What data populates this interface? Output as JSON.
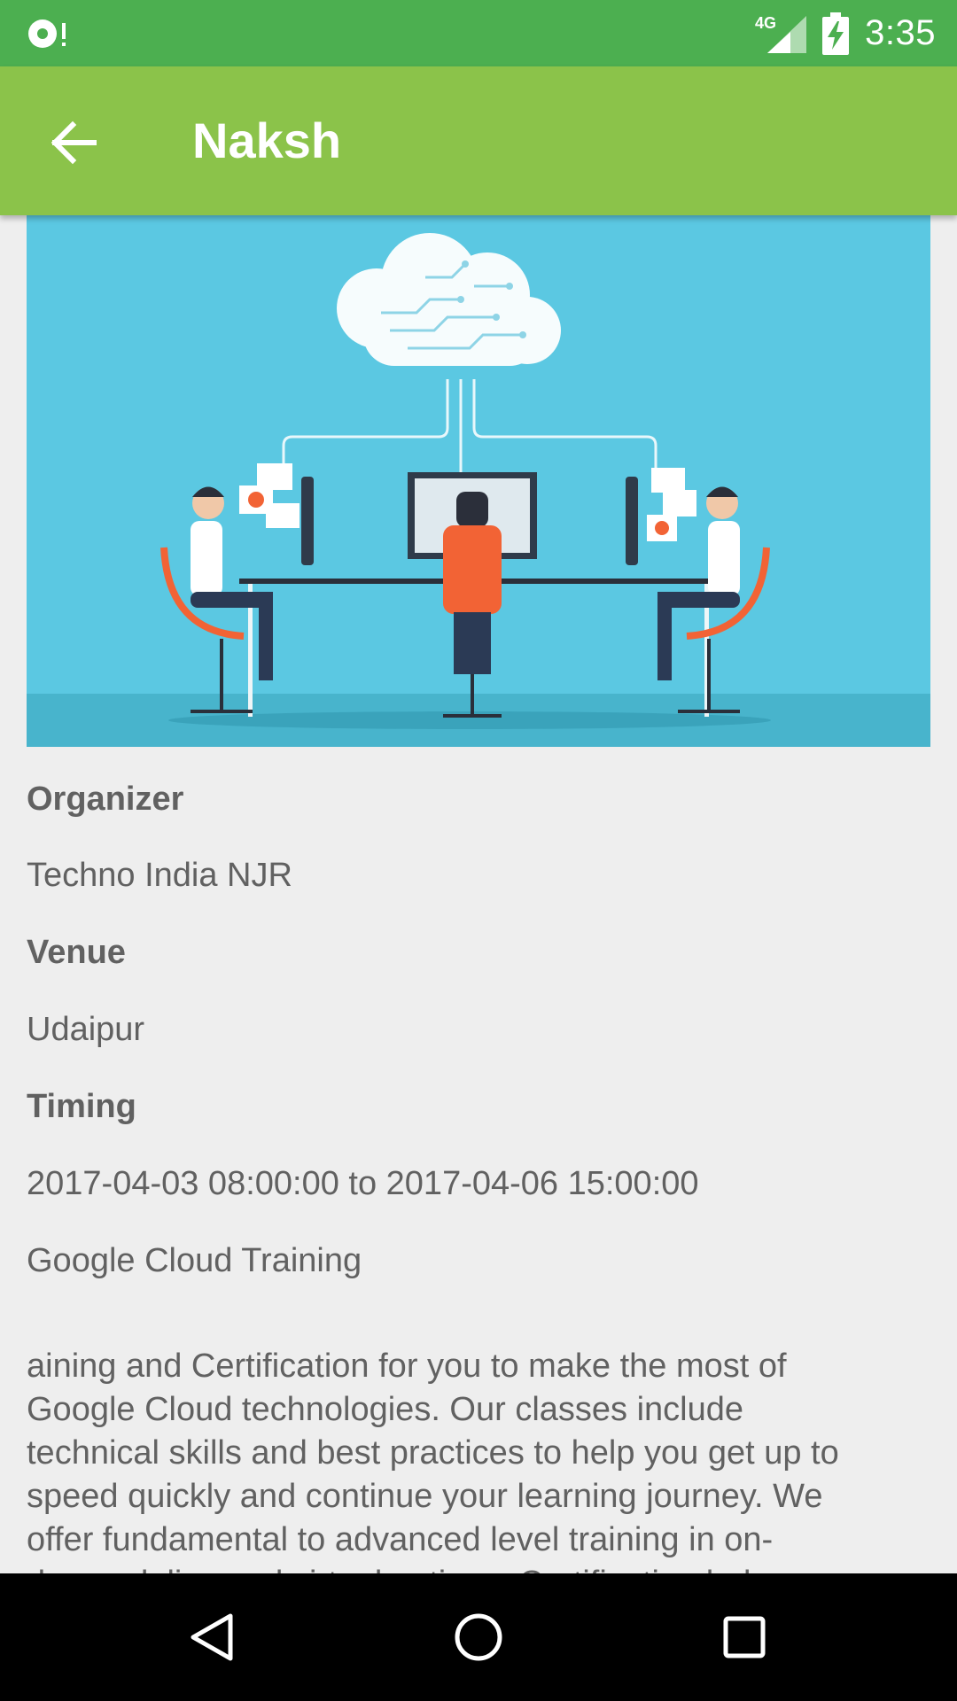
{
  "status_bar": {
    "time": "3:35",
    "network": "4G",
    "icons": [
      "notification-icon",
      "signal-icon",
      "battery-charging-icon"
    ]
  },
  "app_bar": {
    "title": "Naksh",
    "back_icon": "arrow-back-icon"
  },
  "event": {
    "banner_image": "cloud-computing-illustration",
    "organizer_label": "Organizer",
    "organizer": "Techno India NJR",
    "venue_label": "Venue",
    "venue": "Udaipur",
    "timing_label": "Timing",
    "timing": "2017-04-03 08:00:00 to 2017-04-06 15:00:00",
    "name": "Google Cloud Training",
    "description": "aining and Certification for you to make the most of\nGoogle Cloud technologies. Our classes include\ntechnical skills and best practices to help you get up to\nspeed quickly and continue your learning journey. We\noffer fundamental to advanced level training in on-\ndemand, live and virtual options. Certification helps"
  },
  "nav_bar": {
    "icons": [
      "back-triangle-icon",
      "home-circle-icon",
      "recents-square-icon"
    ]
  },
  "colors": {
    "status_bar": "#4caf50",
    "app_bar": "#8bc34a",
    "banner_bg": "#5bc8e2",
    "text": "#616161",
    "background": "#eeeeee"
  }
}
